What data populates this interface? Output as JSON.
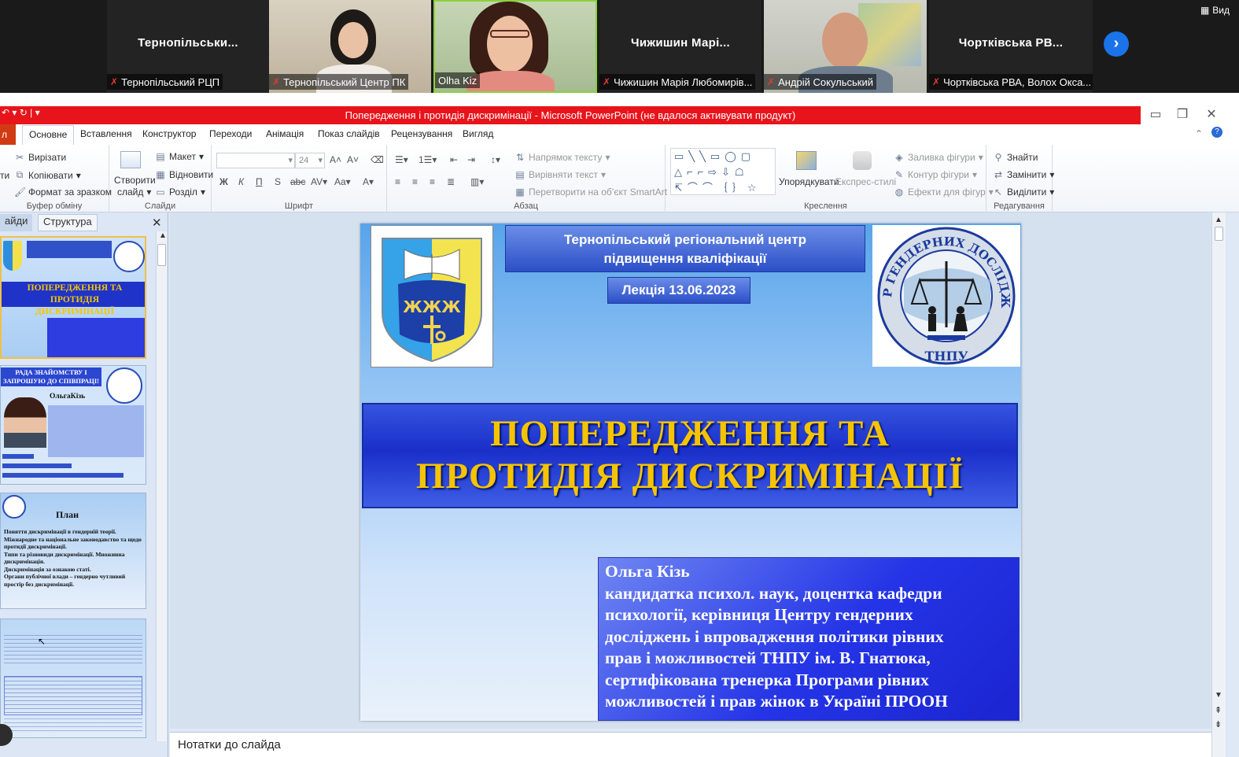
{
  "gallery": {
    "view_label": "Вид",
    "tiles": [
      {
        "display_name": "Тернопільськи...",
        "name_bar": "Тернопільський РЦП"
      },
      {
        "name_bar": "Тернопільський Центр ПК"
      },
      {
        "name_bar": "Olha Kiz"
      },
      {
        "display_name": "Чижишин Марі...",
        "name_bar": "Чижишин Марія Любомирів..."
      },
      {
        "name_bar": "Андрій Сокульський"
      },
      {
        "display_name": "Чортківська РВ...",
        "name_bar": "Чортківська РВА, Волох Окса..."
      }
    ]
  },
  "window": {
    "title": "Попередження і протидія дискримінації  -  Microsoft PowerPoint (не вдалося активувати продукт)"
  },
  "tabs": [
    "Основне",
    "Вставлення",
    "Конструктор",
    "Переходи",
    "Анімація",
    "Показ слайдів",
    "Рецензування",
    "Вигляд"
  ],
  "file_tab": "л",
  "ribbon": {
    "clipboard": {
      "cut": "Вирізати",
      "copy": "Копіювати",
      "format": "Формат за зразком",
      "label": "Буфер обміну"
    },
    "slides": {
      "new_line1": "Створити",
      "new_line2": "слайд",
      "layout": "Макет",
      "reset": "Відновити",
      "section": "Розділ",
      "label": "Слайди"
    },
    "font": {
      "size": "24",
      "label": "Шрифт"
    },
    "paragraph": {
      "direction": "Напрямок тексту",
      "align": "Вирівняти текст",
      "smartart": "Перетворити на об’єкт SmartArt",
      "label": "Абзац"
    },
    "drawing": {
      "arrange": "Упорядкувати",
      "quick_styles": "Експрес-стилі",
      "fill": "Заливка фігури",
      "outline": "Контур фігури",
      "effects": "Ефекти для фігур",
      "label": "Креслення"
    },
    "editing": {
      "find": "Знайти",
      "replace": "Замінити",
      "select": "Виділити",
      "label": "Редагування"
    }
  },
  "pane": {
    "tab_slides": "айди",
    "tab_outline": "Структура",
    "thumb1": {
      "title": "ПОПЕРЕДЖЕННЯ ТА ПРОТИДІЯ ДИСКРИМІНАЦІЇ"
    },
    "thumb2": {
      "title": "РАДА ЗНАЙОМСТВУ І ЗАПРОШУЮ ДО СПІВПРАЦІ!",
      "name": "ОльгаКізь"
    },
    "thumb3": {
      "title": "План",
      "items": [
        "Поняття дискримінації в гендерній теорії.",
        "Міжнародне та національне законодавство та щодо протидії дискримінації.",
        "Типи та різновиди дискримінації. Множинна дискримінація.",
        "Дискримінація за ознакою статі.",
        "Органи публічної влади – гендерно чутливий простір без дискримінації."
      ]
    }
  },
  "slide": {
    "org_line1": "Тернопільський  регіональний центр",
    "org_line2": "підвищення кваліфікації",
    "date": "Лекція 13.06.2023",
    "title_line1": "ПОПЕРЕДЖЕННЯ ТА",
    "title_line2": "ПРОТИДІЯ ДИСКРИМІНАЦІЇ",
    "author_lines": [
      "Ольга Кізь",
      "кандидатка психол. наук,  доцентка кафедри",
      "психології, керівниця Центру гендерних",
      "досліджень і впровадження політики рівних",
      "прав  і можливостей ТНПУ ім. В. Гнатюка,",
      "сертифікована тренерка Програми рівних",
      "можливостей і прав жінок в Україні  ПРООН"
    ],
    "logo_text_top": "ЦЕНТР ГЕНДЕРНИХ ДОСЛІДЖЕНЬ",
    "logo_text_bottom": "ТНПУ"
  },
  "notes": {
    "placeholder": "Нотатки до слайда"
  }
}
